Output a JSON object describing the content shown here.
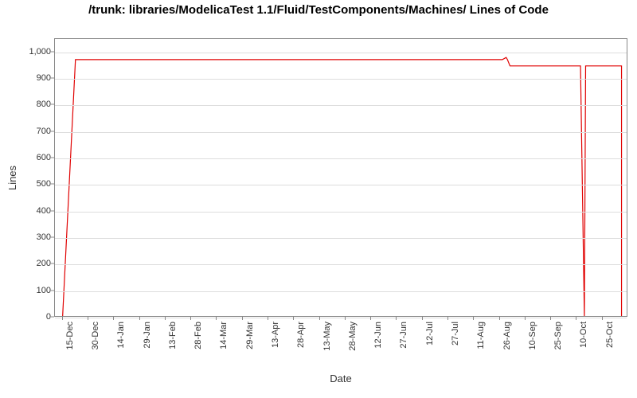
{
  "chart_data": {
    "type": "line",
    "title": "/trunk: libraries/ModelicaTest 1.1/Fluid/TestComponents/Machines/\nLines of Code",
    "xlabel": "Date",
    "ylabel": "Lines",
    "ylim": [
      0,
      1050
    ],
    "yticks": [
      0,
      100,
      200,
      300,
      400,
      500,
      600,
      700,
      800,
      900,
      1000
    ],
    "xticks": [
      "15-Dec",
      "30-Dec",
      "14-Jan",
      "29-Jan",
      "13-Feb",
      "28-Feb",
      "14-Mar",
      "29-Mar",
      "13-Apr",
      "28-Apr",
      "13-May",
      "28-May",
      "12-Jun",
      "27-Jun",
      "12-Jul",
      "27-Jul",
      "11-Aug",
      "26-Aug",
      "10-Sep",
      "25-Sep",
      "10-Oct",
      "25-Oct"
    ],
    "series": [
      {
        "name": "Lines of Code",
        "color": "#e00000",
        "x": [
          0,
          0.5,
          17.15,
          17.3,
          17.35,
          17.45,
          20.2,
          20.35,
          20.4,
          21.8,
          21.8
        ],
        "values": [
          0,
          972,
          972,
          980,
          972,
          948,
          948,
          0,
          948,
          948,
          0
        ]
      }
    ],
    "xlim": [
      -0.3,
      22
    ]
  }
}
